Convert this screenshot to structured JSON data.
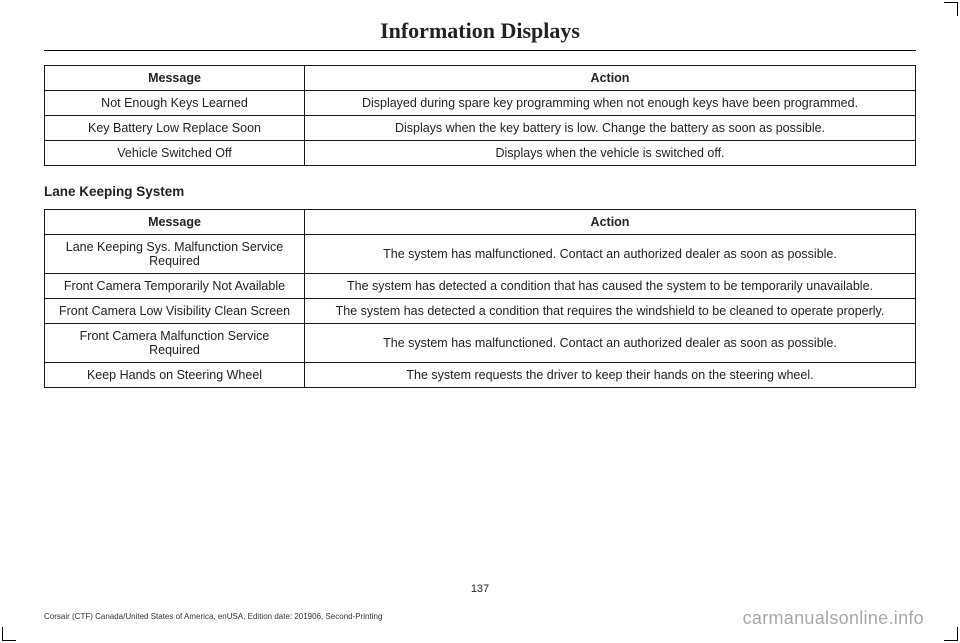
{
  "header": {
    "title": "Information Displays"
  },
  "table1": {
    "headers": {
      "message": "Message",
      "action": "Action"
    },
    "rows": [
      {
        "message": "Not Enough Keys Learned",
        "action": "Displayed during spare key programming when not enough keys have been programmed."
      },
      {
        "message": "Key Battery Low Replace Soon",
        "action": "Displays when the key battery is low. Change the battery as soon as possible."
      },
      {
        "message": "Vehicle Switched Off",
        "action": "Displays when the vehicle is switched off."
      }
    ]
  },
  "section2": {
    "title": "Lane Keeping System"
  },
  "table2": {
    "headers": {
      "message": "Message",
      "action": "Action"
    },
    "rows": [
      {
        "message": "Lane Keeping Sys. Malfunction Service Required",
        "action": "The system has malfunctioned. Contact an authorized dealer as soon as possible."
      },
      {
        "message": "Front Camera Temporarily Not Available",
        "action": "The system has detected a condition that has caused the system to be temporarily unavailable."
      },
      {
        "message": "Front Camera Low Visibility Clean Screen",
        "action": "The system has detected a condition that requires the windshield to be cleaned to operate properly."
      },
      {
        "message": "Front Camera Malfunction Service Required",
        "action": "The system has malfunctioned. Contact an authorized dealer as soon as possible."
      },
      {
        "message": "Keep Hands on Steering Wheel",
        "action": "The system requests the driver to keep their hands on the steering wheel."
      }
    ]
  },
  "page_number": "137",
  "footer": "Corsair (CTF) Canada/United States of America, enUSA, Edition date: 201906, Second-Printing",
  "watermark": "carmanualsonline.info"
}
